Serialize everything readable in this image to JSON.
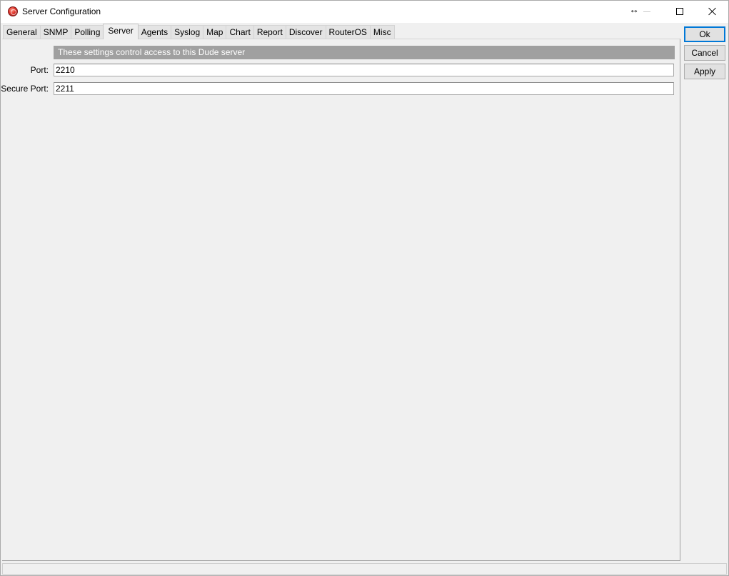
{
  "window": {
    "title": "Server Configuration",
    "resize_glyph": "↔"
  },
  "tabs": [
    {
      "label": "General"
    },
    {
      "label": "SNMP"
    },
    {
      "label": "Polling"
    },
    {
      "label": "Server",
      "active": true
    },
    {
      "label": "Agents"
    },
    {
      "label": "Syslog"
    },
    {
      "label": "Map"
    },
    {
      "label": "Chart"
    },
    {
      "label": "Report"
    },
    {
      "label": "Discover"
    },
    {
      "label": "RouterOS"
    },
    {
      "label": "Misc"
    }
  ],
  "server_tab": {
    "banner": "These settings control access to this Dude server",
    "port": {
      "label": "Port:",
      "value": "2210"
    },
    "secure_port": {
      "label": "Secure Port:",
      "value": "2211"
    }
  },
  "buttons": {
    "ok": "Ok",
    "cancel": "Cancel",
    "apply": "Apply"
  },
  "icons": {
    "app": "dude-app-icon",
    "resize": "resize-horizontal-icon",
    "minimize": "minimize-icon",
    "maximize": "maximize-icon",
    "close": "close-icon"
  },
  "colors": {
    "banner_bg": "#a0a0a0",
    "default_button_border": "#0078d7"
  }
}
